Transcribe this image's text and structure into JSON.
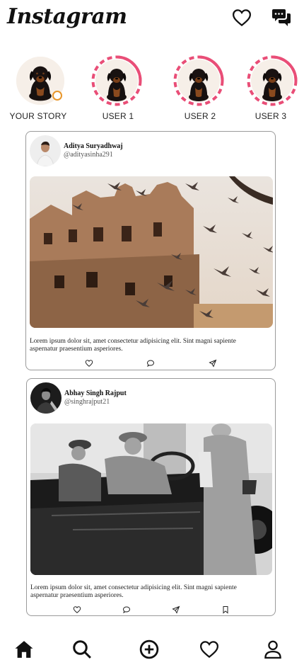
{
  "app": {
    "logo_text": "Instagram",
    "accent_story_ring": "#e94e77",
    "badge_color": "#e8962a"
  },
  "header": {
    "icons": [
      "heart-icon",
      "messenger-icon"
    ]
  },
  "stories": [
    {
      "label": "YOUR STORY",
      "own": true
    },
    {
      "label": "USER 1"
    },
    {
      "label": "USER 2"
    },
    {
      "label": "USER 3"
    }
  ],
  "posts": [
    {
      "name": "Aditya Suryadhwaj",
      "handle": "@adityasinha291",
      "image": "palace-with-pigeons-photo",
      "caption": "Lorem ipsum dolor sit, amet consectetur adipisicing elit. Sint magni sapiente aspernatur praesentium asperiores.",
      "actions": [
        "heart-icon",
        "comment-icon",
        "share-icon"
      ]
    },
    {
      "name": "Abhay Singh Rajput",
      "handle": "@singhrajput21",
      "image": "vintage-car-black-white-photo",
      "caption": "Lorem ipsum dolor sit, amet consectetur adipisicing elit. Sint magni sapiente aspernatur praesentium asperiores.",
      "actions": [
        "heart-icon",
        "comment-icon",
        "share-icon",
        "bookmark-icon"
      ]
    }
  ],
  "bottom_nav": [
    "home-icon",
    "search-icon",
    "add-post-icon",
    "activity-heart-icon",
    "profile-icon"
  ]
}
